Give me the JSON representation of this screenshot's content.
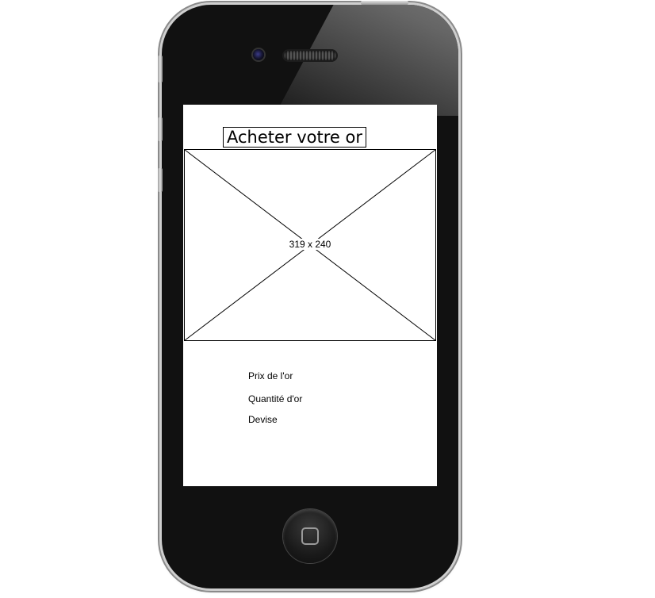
{
  "screen": {
    "title": "Acheter votre or",
    "image_placeholder": {
      "label": "319 x 240"
    },
    "fields": [
      {
        "label": "Prix de l'or"
      },
      {
        "label": "Quantité d'or"
      },
      {
        "label": "Devise"
      }
    ]
  },
  "device": {
    "type": "iphone-4",
    "icons": [
      "front-camera-icon",
      "speaker-grille-icon",
      "home-button-icon"
    ]
  }
}
